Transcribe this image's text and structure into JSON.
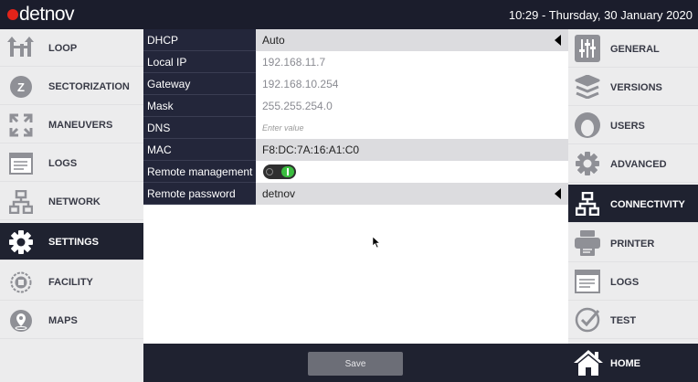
{
  "header": {
    "brand": "detnov",
    "brand_dot_color": "#e2231a",
    "datetime": "10:29  -  Thursday, 30 January 2020"
  },
  "left_nav": {
    "items": [
      {
        "label": "LOOP",
        "icon": "loop-icon"
      },
      {
        "label": "SECTORIZATION",
        "icon": "sectorization-icon"
      },
      {
        "label": "MANEUVERS",
        "icon": "maneuvers-icon"
      },
      {
        "label": "LOGS",
        "icon": "logs-icon"
      },
      {
        "label": "NETWORK",
        "icon": "network-icon"
      },
      {
        "label": "SETTINGS",
        "icon": "gear-icon",
        "active": true
      },
      {
        "label": "FACILITY",
        "icon": "facility-icon"
      },
      {
        "label": "MAPS",
        "icon": "map-pin-icon"
      }
    ]
  },
  "form": {
    "rows": [
      {
        "label": "DHCP",
        "value": "Auto"
      },
      {
        "label": "Local IP",
        "value": "192.168.11.7"
      },
      {
        "label": "Gateway",
        "value": "192.168.10.254"
      },
      {
        "label": "Mask",
        "value": "255.255.254.0"
      },
      {
        "label": "DNS",
        "placeholder": "Enter value"
      },
      {
        "label": "MAC",
        "value": "F8:DC:7A:16:A1:C0"
      },
      {
        "label": "Remote management",
        "toggle": "on"
      },
      {
        "label": "Remote password",
        "value": "detnov"
      }
    ]
  },
  "bottom_bar": {
    "save_label": "Save"
  },
  "right_nav": {
    "items": [
      {
        "label": "GENERAL",
        "icon": "general-icon"
      },
      {
        "label": "VERSIONS",
        "icon": "layers-icon"
      },
      {
        "label": "USERS",
        "icon": "user-icon"
      },
      {
        "label": "ADVANCED",
        "icon": "gear-icon"
      },
      {
        "label": "CONNECTIVITY",
        "icon": "network-icon",
        "active": true
      },
      {
        "label": "PRINTER",
        "icon": "printer-icon"
      },
      {
        "label": "LOGS",
        "icon": "logs-icon"
      },
      {
        "label": "TEST",
        "icon": "check-icon"
      }
    ],
    "home_label": "HOME"
  },
  "colors": {
    "header_bg": "#1b1d2c",
    "active_bg": "#1f2230",
    "sidebar_bg": "#ececed",
    "toggle_on": "#3bbd3f"
  }
}
